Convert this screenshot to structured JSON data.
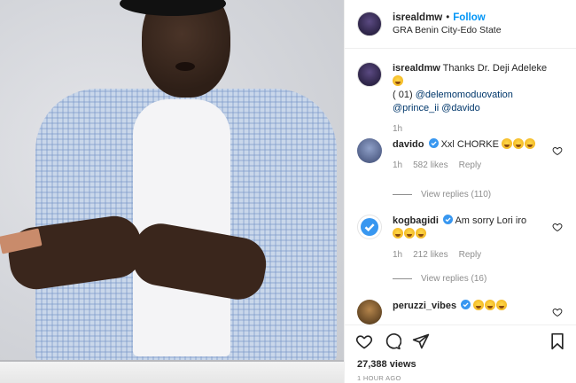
{
  "header": {
    "username": "isrealdmw",
    "separator": "•",
    "follow_label": "Follow",
    "location": "GRA Benin City-Edo State"
  },
  "caption": {
    "username": "isrealdmw",
    "text_prefix": "Thanks Dr. Deji Adeleke",
    "text_mid": "( 01)",
    "mention_1": "@delemomoduovation",
    "mention_2": "@prince_ii",
    "mention_3": "@davido",
    "time": "1h"
  },
  "comments": [
    {
      "username": "davido",
      "text": "Xxl CHORKE",
      "time": "1h",
      "likes": "582 likes",
      "reply_label": "Reply",
      "view_replies": "View replies (110)"
    },
    {
      "username": "kogbagidi",
      "text": "Am sorry Lori iro",
      "time": "1h",
      "likes": "212 likes",
      "reply_label": "Reply",
      "view_replies": "View replies (16)"
    },
    {
      "username": "peruzzi_vibes"
    }
  ],
  "footer": {
    "views": "27,388 views",
    "timestamp": "1 HOUR AGO"
  },
  "icons": [
    "heart-icon",
    "comment-icon",
    "share-icon",
    "bookmark-icon",
    "verified-icon"
  ],
  "colors": {
    "link": "#0095f6",
    "mention": "#00376b",
    "muted": "#8e8e8e",
    "verified": "#3897f0"
  }
}
